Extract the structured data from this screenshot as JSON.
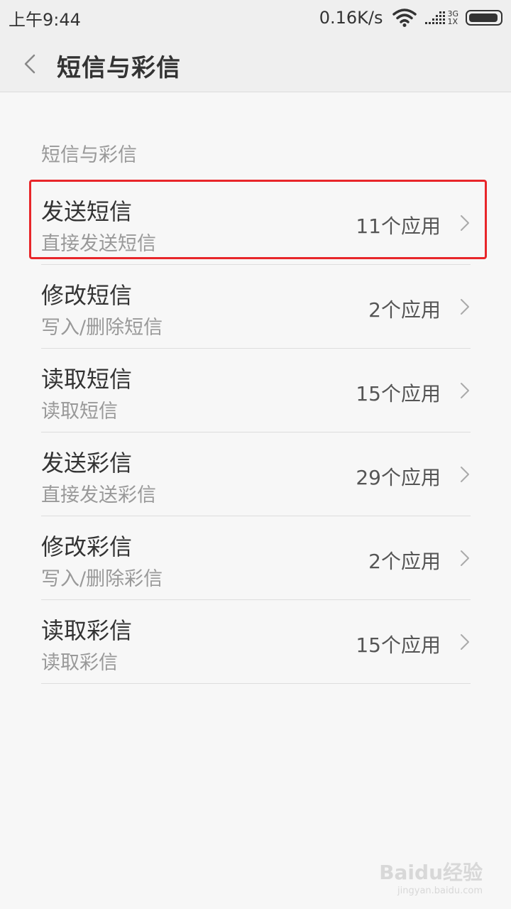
{
  "status_bar": {
    "time": "上午9:44",
    "net_speed": "0.16K/s",
    "net_type_top": "3G",
    "net_type_bottom": "1X",
    "icons": [
      "wifi-icon",
      "signal-icon",
      "battery-icon"
    ]
  },
  "header": {
    "back_icon": "chevron-left-icon",
    "title": "短信与彩信"
  },
  "section": {
    "title": "短信与彩信"
  },
  "items": [
    {
      "title": "发送短信",
      "subtitle": "直接发送短信",
      "count": "11个应用",
      "highlighted": true
    },
    {
      "title": "修改短信",
      "subtitle": "写入/删除短信",
      "count": "2个应用"
    },
    {
      "title": "读取短信",
      "subtitle": "读取短信",
      "count": "15个应用"
    },
    {
      "title": "发送彩信",
      "subtitle": "直接发送彩信",
      "count": "29个应用"
    },
    {
      "title": "修改彩信",
      "subtitle": "写入/删除彩信",
      "count": "2个应用"
    },
    {
      "title": "读取彩信",
      "subtitle": "读取彩信",
      "count": "15个应用"
    }
  ],
  "watermark": {
    "main": "Baidu经验",
    "sub": "jingyan.baidu.com"
  },
  "colors": {
    "highlight": "#e8262a",
    "background": "#f7f7f7",
    "title_bar": "#efefef"
  }
}
